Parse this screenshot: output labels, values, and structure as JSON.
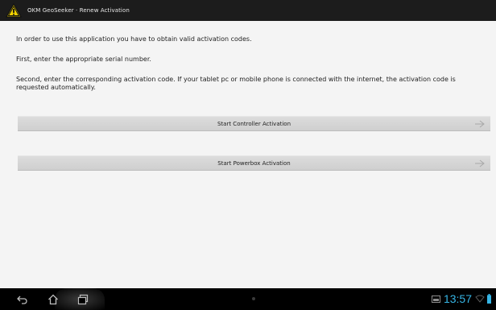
{
  "titlebar": {
    "title": "OKM GeoSeeker · Renew Activation",
    "logo_icon": "warning-triangle-icon",
    "accent_color": "#f2d300"
  },
  "content": {
    "line1": "In order to use this application you have to obtain valid activation codes.",
    "line2": "First, enter the appropriate serial number.",
    "line3": "Second, enter the corresponding activation code. If your tablet pc or mobile phone is connected with the internet, the activation code is requested automatically."
  },
  "buttons": {
    "controller_label": "Start Controller Activation",
    "powerbox_label": "Start Powerbox Activation",
    "arrow_icon": "arrow-right-icon"
  },
  "navbar": {
    "back_icon": "back-icon",
    "home_icon": "home-icon",
    "recent_icon": "recent-apps-icon"
  },
  "status": {
    "time": "13:57",
    "time_color": "#36b6e6",
    "icons": [
      "notification-icon",
      "wifi-icon",
      "battery-icon"
    ]
  }
}
